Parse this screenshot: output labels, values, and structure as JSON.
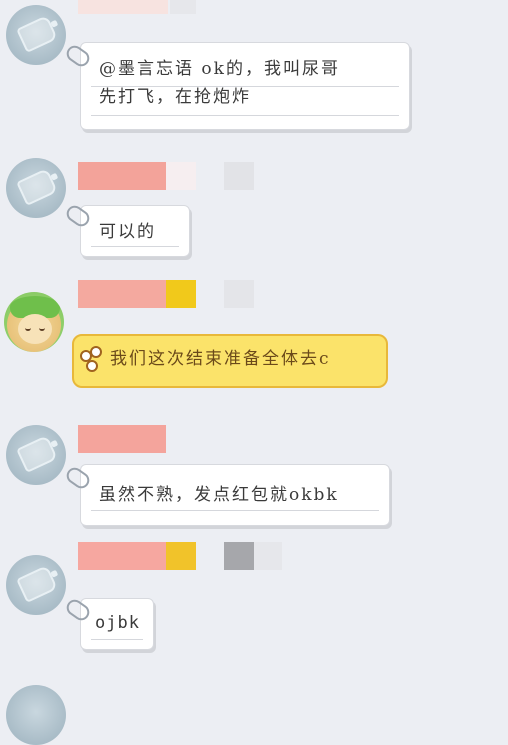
{
  "messages": [
    {
      "text": "@墨言忘语 ok的，我叫尿哥\n先打飞，在抢炮炸"
    },
    {
      "text": "可以的"
    },
    {
      "text": "我们这次结束准备全体去c"
    },
    {
      "text": "虽然不熟，发点红包就okbk"
    },
    {
      "text": "ojbk"
    }
  ],
  "colors": {
    "background": "#eceef3",
    "name_blur_pink": "#f3a39a",
    "name_blur_yellow": "#f1c91b",
    "name_blur_gray": "#a6a7ab",
    "yellow_bubble": "#fbe36a"
  }
}
